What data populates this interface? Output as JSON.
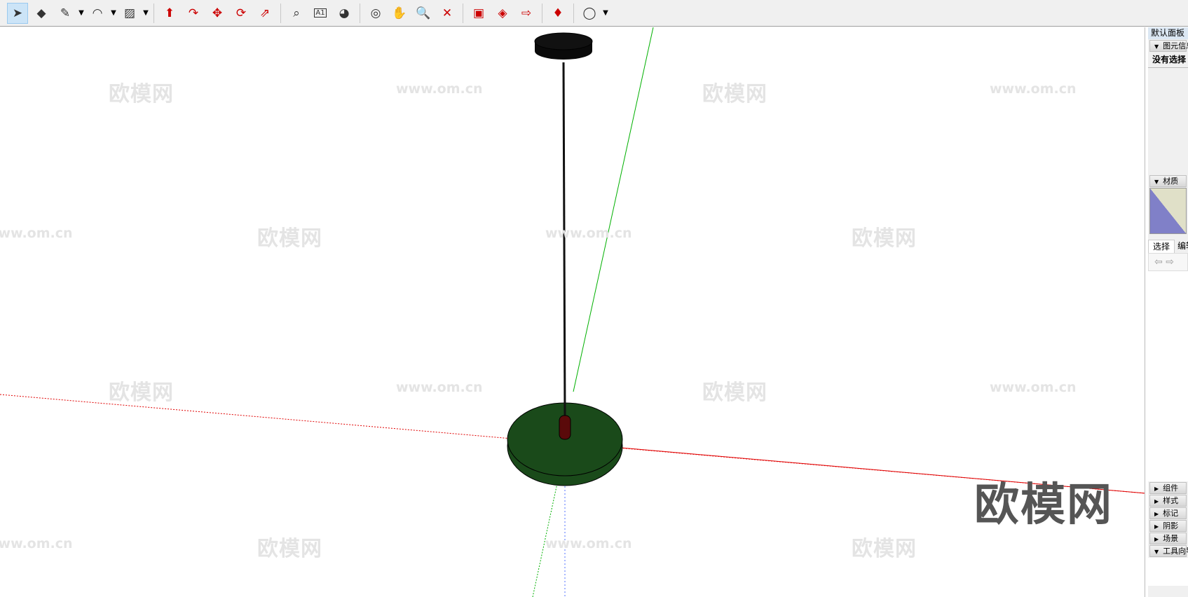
{
  "toolbar": {
    "tools": [
      {
        "name": "select-tool",
        "glyph": "➤",
        "active": true
      },
      {
        "name": "eraser-tool",
        "glyph": "◆"
      },
      {
        "name": "pencil-tool",
        "glyph": "✎",
        "dropdown": true
      },
      {
        "name": "arc-tool",
        "glyph": "◠",
        "dropdown": true
      },
      {
        "name": "rectangle-tool",
        "glyph": "▨",
        "dropdown": true
      },
      {
        "sep": true
      },
      {
        "name": "push-pull-tool",
        "glyph": "⬆"
      },
      {
        "name": "follow-me-tool",
        "glyph": "↷"
      },
      {
        "name": "move-tool",
        "glyph": "✥"
      },
      {
        "name": "rotate-tool",
        "glyph": "⟳"
      },
      {
        "name": "scale-tool",
        "glyph": "⇗"
      },
      {
        "sep": true
      },
      {
        "name": "tape-measure-tool",
        "glyph": "⌕"
      },
      {
        "name": "text-tool",
        "glyph": "A1"
      },
      {
        "name": "paint-bucket-tool",
        "glyph": "◕"
      },
      {
        "sep": true
      },
      {
        "name": "orbit-tool",
        "glyph": "◎"
      },
      {
        "name": "pan-tool",
        "glyph": "✋"
      },
      {
        "name": "zoom-tool",
        "glyph": "🔍"
      },
      {
        "name": "zoom-extents-tool",
        "glyph": "✕"
      },
      {
        "sep": true
      },
      {
        "name": "3d-warehouse-button",
        "glyph": "▣"
      },
      {
        "name": "extension-warehouse-button",
        "glyph": "◈"
      },
      {
        "name": "send-to-layout-button",
        "glyph": "⇨"
      },
      {
        "sep": true
      },
      {
        "name": "extension-manager-button",
        "glyph": "♦"
      },
      {
        "sep": true
      },
      {
        "name": "account-button",
        "glyph": "◯",
        "dropdown": true
      }
    ]
  },
  "watermark": {
    "logo": "欧模网",
    "url": "www.om.cn"
  },
  "colors": {
    "x_axis": "#e00000",
    "y_axis": "#00a000",
    "base": "#1a4a1a"
  },
  "panel": {
    "title": "默认面板",
    "entity_info": {
      "label": "图元信息",
      "status": "没有选择"
    },
    "materials": {
      "label": "材质"
    },
    "tabs": [
      "选择",
      "编辑"
    ],
    "sections": [
      "组件",
      "样式",
      "标记",
      "阴影",
      "场景",
      "工具向导"
    ]
  }
}
